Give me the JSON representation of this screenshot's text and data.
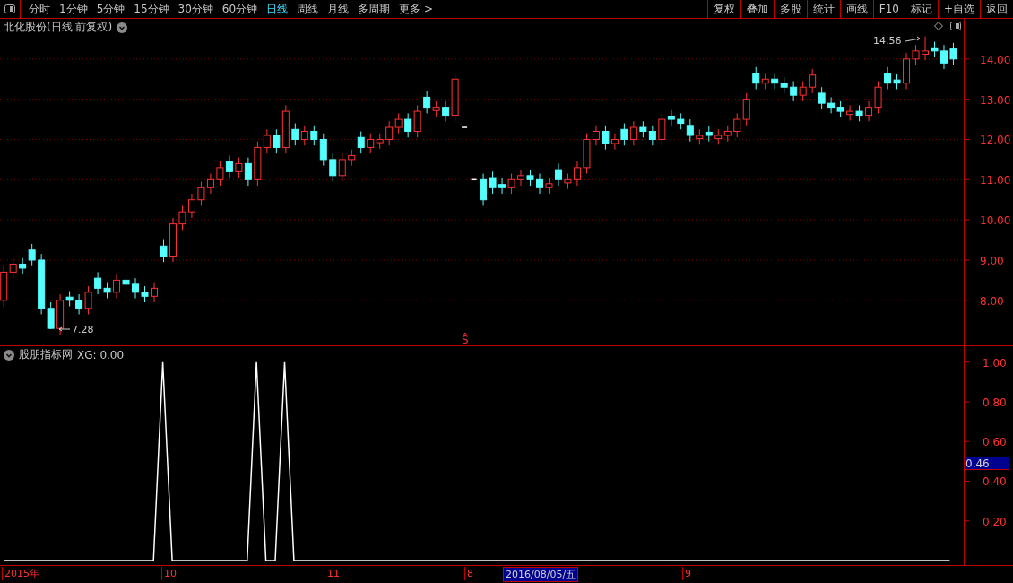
{
  "toolbar": {
    "periods": [
      {
        "label": "分时",
        "selected": false
      },
      {
        "label": "1分钟",
        "selected": false
      },
      {
        "label": "5分钟",
        "selected": false
      },
      {
        "label": "15分钟",
        "selected": false
      },
      {
        "label": "30分钟",
        "selected": false
      },
      {
        "label": "60分钟",
        "selected": false
      },
      {
        "label": "日线",
        "selected": true
      },
      {
        "label": "周线",
        "selected": false
      },
      {
        "label": "月线",
        "selected": false
      },
      {
        "label": "多周期",
        "selected": false
      },
      {
        "label": "更多 >",
        "selected": false
      }
    ],
    "buttons": [
      "复权",
      "叠加",
      "多股",
      "统计",
      "画线",
      "F10",
      "标记",
      "+自选",
      "返回"
    ]
  },
  "price_panel": {
    "title": "北化股份(日线.前复权)",
    "high_marker": "14.56",
    "low_marker": "7.28",
    "event_marker": "Ŝ",
    "chart_data": {
      "type": "candlestick",
      "grid": true,
      "categories": [
        null,
        null,
        null,
        null,
        null,
        null,
        null,
        null,
        null,
        null,
        null,
        null,
        null,
        null,
        null,
        null,
        null,
        null,
        null,
        null,
        null,
        null,
        null,
        null,
        null,
        null,
        null,
        null,
        null,
        null,
        null,
        null,
        null,
        null,
        null,
        null,
        null,
        null,
        null,
        null,
        null,
        null,
        null,
        null,
        null,
        null,
        null,
        null,
        null,
        null,
        null,
        null,
        null,
        null,
        null,
        null,
        null,
        null,
        null,
        null,
        null,
        null,
        null,
        null,
        null,
        null,
        null,
        null,
        null,
        null,
        null,
        null,
        null,
        null,
        null,
        null,
        null,
        null,
        null,
        null,
        null,
        null,
        null,
        null,
        null,
        null,
        null,
        null,
        null,
        null,
        null,
        null,
        null,
        null,
        null,
        null,
        null,
        null,
        null,
        null,
        null,
        null
      ],
      "ylim": [
        6.88,
        15.0
      ],
      "yticks": [
        {
          "value": 14,
          "label": "14.00"
        },
        {
          "value": 13,
          "label": "13.00"
        },
        {
          "value": 12,
          "label": "12.00"
        },
        {
          "value": 11,
          "label": "11.00"
        },
        {
          "value": 10,
          "label": "10.00"
        },
        {
          "value": 9,
          "label": "9.00"
        },
        {
          "value": 8,
          "label": "8.00"
        }
      ],
      "ohlc": [
        [
          8.0,
          8.85,
          7.85,
          8.7
        ],
        [
          8.7,
          9.05,
          8.55,
          8.9
        ],
        [
          8.9,
          9.05,
          8.65,
          8.8
        ],
        [
          9.25,
          9.4,
          8.85,
          9.0
        ],
        [
          9.0,
          9.15,
          7.65,
          7.8
        ],
        [
          7.8,
          7.95,
          7.28,
          7.3
        ],
        [
          7.3,
          8.15,
          7.15,
          8.0
        ],
        [
          8.08,
          8.23,
          7.85,
          8.0
        ],
        [
          8.0,
          8.15,
          7.65,
          7.8
        ],
        [
          7.8,
          8.35,
          7.65,
          8.2
        ],
        [
          8.55,
          8.7,
          8.15,
          8.3
        ],
        [
          8.3,
          8.45,
          8.05,
          8.2
        ],
        [
          8.2,
          8.65,
          8.05,
          8.5
        ],
        [
          8.5,
          8.65,
          8.25,
          8.4
        ],
        [
          8.4,
          8.55,
          8.05,
          8.2
        ],
        [
          8.2,
          8.35,
          7.95,
          8.1
        ],
        [
          8.1,
          8.45,
          7.95,
          8.3
        ],
        [
          9.35,
          9.5,
          8.95,
          9.1
        ],
        [
          9.1,
          10.05,
          8.95,
          9.9
        ],
        [
          9.9,
          10.35,
          9.75,
          10.2
        ],
        [
          10.2,
          10.65,
          10.05,
          10.5
        ],
        [
          10.5,
          10.95,
          10.35,
          10.8
        ],
        [
          10.8,
          11.15,
          10.65,
          11.0
        ],
        [
          11.0,
          11.45,
          10.85,
          11.3
        ],
        [
          11.45,
          11.6,
          11.05,
          11.2
        ],
        [
          11.2,
          11.55,
          11.05,
          11.4
        ],
        [
          11.4,
          11.55,
          10.85,
          11.0
        ],
        [
          11.0,
          11.95,
          10.85,
          11.8
        ],
        [
          11.8,
          12.25,
          11.65,
          12.1
        ],
        [
          12.1,
          12.25,
          11.65,
          11.8
        ],
        [
          11.8,
          12.85,
          11.65,
          12.7
        ],
        [
          12.25,
          12.4,
          11.85,
          12.0
        ],
        [
          12.0,
          12.35,
          11.85,
          12.2
        ],
        [
          12.2,
          12.35,
          11.85,
          12.0
        ],
        [
          12.0,
          12.15,
          11.35,
          11.5
        ],
        [
          11.5,
          11.65,
          10.95,
          11.1
        ],
        [
          11.1,
          11.65,
          10.95,
          11.5
        ],
        [
          11.5,
          11.75,
          11.35,
          11.6
        ],
        [
          12.05,
          12.2,
          11.65,
          11.8
        ],
        [
          11.8,
          12.15,
          11.65,
          12.0
        ],
        [
          11.92,
          12.15,
          11.77,
          12.0
        ],
        [
          12.0,
          12.45,
          11.85,
          12.3
        ],
        [
          12.3,
          12.65,
          12.15,
          12.5
        ],
        [
          12.5,
          12.65,
          12.05,
          12.2
        ],
        [
          12.2,
          12.85,
          12.05,
          12.7
        ],
        [
          13.05,
          13.2,
          12.65,
          12.8
        ],
        [
          12.72,
          12.95,
          12.57,
          12.8
        ],
        [
          12.8,
          12.95,
          12.45,
          12.6
        ],
        [
          12.6,
          13.65,
          12.45,
          13.5
        ],
        [
          12.3,
          12.3,
          12.3,
          12.3
        ],
        [
          11.0,
          11.0,
          11.0,
          11.0
        ],
        [
          11.0,
          11.15,
          10.35,
          10.5
        ],
        [
          11.05,
          11.2,
          10.65,
          10.8
        ],
        [
          10.88,
          11.03,
          10.65,
          10.8
        ],
        [
          10.8,
          11.15,
          10.65,
          11.0
        ],
        [
          11.0,
          11.25,
          10.85,
          11.1
        ],
        [
          11.1,
          11.25,
          10.85,
          11.0
        ],
        [
          11.0,
          11.15,
          10.65,
          10.8
        ],
        [
          10.8,
          11.05,
          10.65,
          10.9
        ],
        [
          11.25,
          11.4,
          10.85,
          11.0
        ],
        [
          10.92,
          11.15,
          10.77,
          11.0
        ],
        [
          11.0,
          11.45,
          10.85,
          11.3
        ],
        [
          11.3,
          12.15,
          11.15,
          12.0
        ],
        [
          12.0,
          12.35,
          11.85,
          12.2
        ],
        [
          12.2,
          12.35,
          11.75,
          11.9
        ],
        [
          11.9,
          12.15,
          11.75,
          12.0
        ],
        [
          12.25,
          12.4,
          11.85,
          12.0
        ],
        [
          12.0,
          12.45,
          11.85,
          12.3
        ],
        [
          12.3,
          12.45,
          12.05,
          12.2
        ],
        [
          12.2,
          12.35,
          11.85,
          12.0
        ],
        [
          12.0,
          12.65,
          11.85,
          12.5
        ],
        [
          12.58,
          12.73,
          12.35,
          12.5
        ],
        [
          12.5,
          12.65,
          12.25,
          12.4
        ],
        [
          12.35,
          12.5,
          11.95,
          12.1
        ],
        [
          12.02,
          12.25,
          11.87,
          12.1
        ],
        [
          12.18,
          12.33,
          11.95,
          12.1
        ],
        [
          12.02,
          12.25,
          11.87,
          12.1
        ],
        [
          12.1,
          12.35,
          11.95,
          12.2
        ],
        [
          12.2,
          12.65,
          12.05,
          12.5
        ],
        [
          12.5,
          13.15,
          12.35,
          13.0
        ],
        [
          13.65,
          13.8,
          13.25,
          13.4
        ],
        [
          13.4,
          13.65,
          13.25,
          13.5
        ],
        [
          13.5,
          13.65,
          13.25,
          13.4
        ],
        [
          13.4,
          13.55,
          13.15,
          13.3
        ],
        [
          13.3,
          13.45,
          12.95,
          13.1
        ],
        [
          13.1,
          13.45,
          12.95,
          13.3
        ],
        [
          13.3,
          13.75,
          13.15,
          13.6
        ],
        [
          13.15,
          13.3,
          12.75,
          12.9
        ],
        [
          12.9,
          13.05,
          12.65,
          12.8
        ],
        [
          12.8,
          12.95,
          12.55,
          12.7
        ],
        [
          12.62,
          12.85,
          12.47,
          12.7
        ],
        [
          12.7,
          12.85,
          12.45,
          12.6
        ],
        [
          12.6,
          12.95,
          12.45,
          12.8
        ],
        [
          12.8,
          13.45,
          12.65,
          13.3
        ],
        [
          13.65,
          13.8,
          13.25,
          13.4
        ],
        [
          13.48,
          13.63,
          13.25,
          13.4
        ],
        [
          13.4,
          14.15,
          13.25,
          14.0
        ],
        [
          14.0,
          14.35,
          13.85,
          14.2
        ],
        [
          14.12,
          14.56,
          13.97,
          14.2
        ],
        [
          14.28,
          14.43,
          14.05,
          14.2
        ],
        [
          14.2,
          14.35,
          13.75,
          13.9
        ],
        [
          14.25,
          14.4,
          13.85,
          14.0
        ]
      ]
    }
  },
  "indicator_panel": {
    "name": "股朋指标网",
    "reading": "XG: 0.00",
    "cursor_value": "0.46",
    "chart_data": {
      "type": "line",
      "ylim": [
        0,
        1.08
      ],
      "yticks": [
        {
          "value": 0.2,
          "label": "0.20"
        },
        {
          "value": 0.4,
          "label": "0.40"
        },
        {
          "value": 0.6,
          "label": "0.60"
        },
        {
          "value": 0.8,
          "label": "0.80"
        },
        {
          "value": 1,
          "label": "1.00"
        }
      ],
      "series": [
        {
          "color": "#ffffff",
          "values": [
            0,
            0,
            0,
            0,
            0,
            0,
            0,
            0,
            0,
            0,
            0,
            0,
            0,
            0,
            0,
            0,
            0,
            1,
            0,
            0,
            0,
            0,
            0,
            0,
            0,
            0,
            0,
            1,
            0,
            0,
            1,
            0,
            0,
            0,
            0,
            0,
            0,
            0,
            0,
            0,
            0,
            0,
            0,
            0,
            0,
            0,
            0,
            0,
            0,
            0,
            0,
            0,
            0,
            0,
            0,
            0,
            0,
            0,
            0,
            0,
            0,
            0,
            0,
            0,
            0,
            0,
            0,
            0,
            0,
            0,
            0,
            0,
            0,
            0,
            0,
            0,
            0,
            0,
            0,
            0,
            0,
            0,
            0,
            0,
            0,
            0,
            0,
            0,
            0,
            0,
            0,
            0,
            0,
            0,
            0,
            0,
            0,
            0,
            0,
            0,
            0,
            0
          ]
        }
      ]
    }
  },
  "date_axis": [
    {
      "label": "2015年",
      "highlighted": false
    },
    {
      "label": "10",
      "highlighted": false
    },
    {
      "label": "11",
      "highlighted": false
    },
    {
      "label": "8",
      "highlighted": false
    },
    {
      "label": "2016/08/05/五",
      "highlighted": true
    },
    {
      "label": "9",
      "highlighted": false
    }
  ]
}
